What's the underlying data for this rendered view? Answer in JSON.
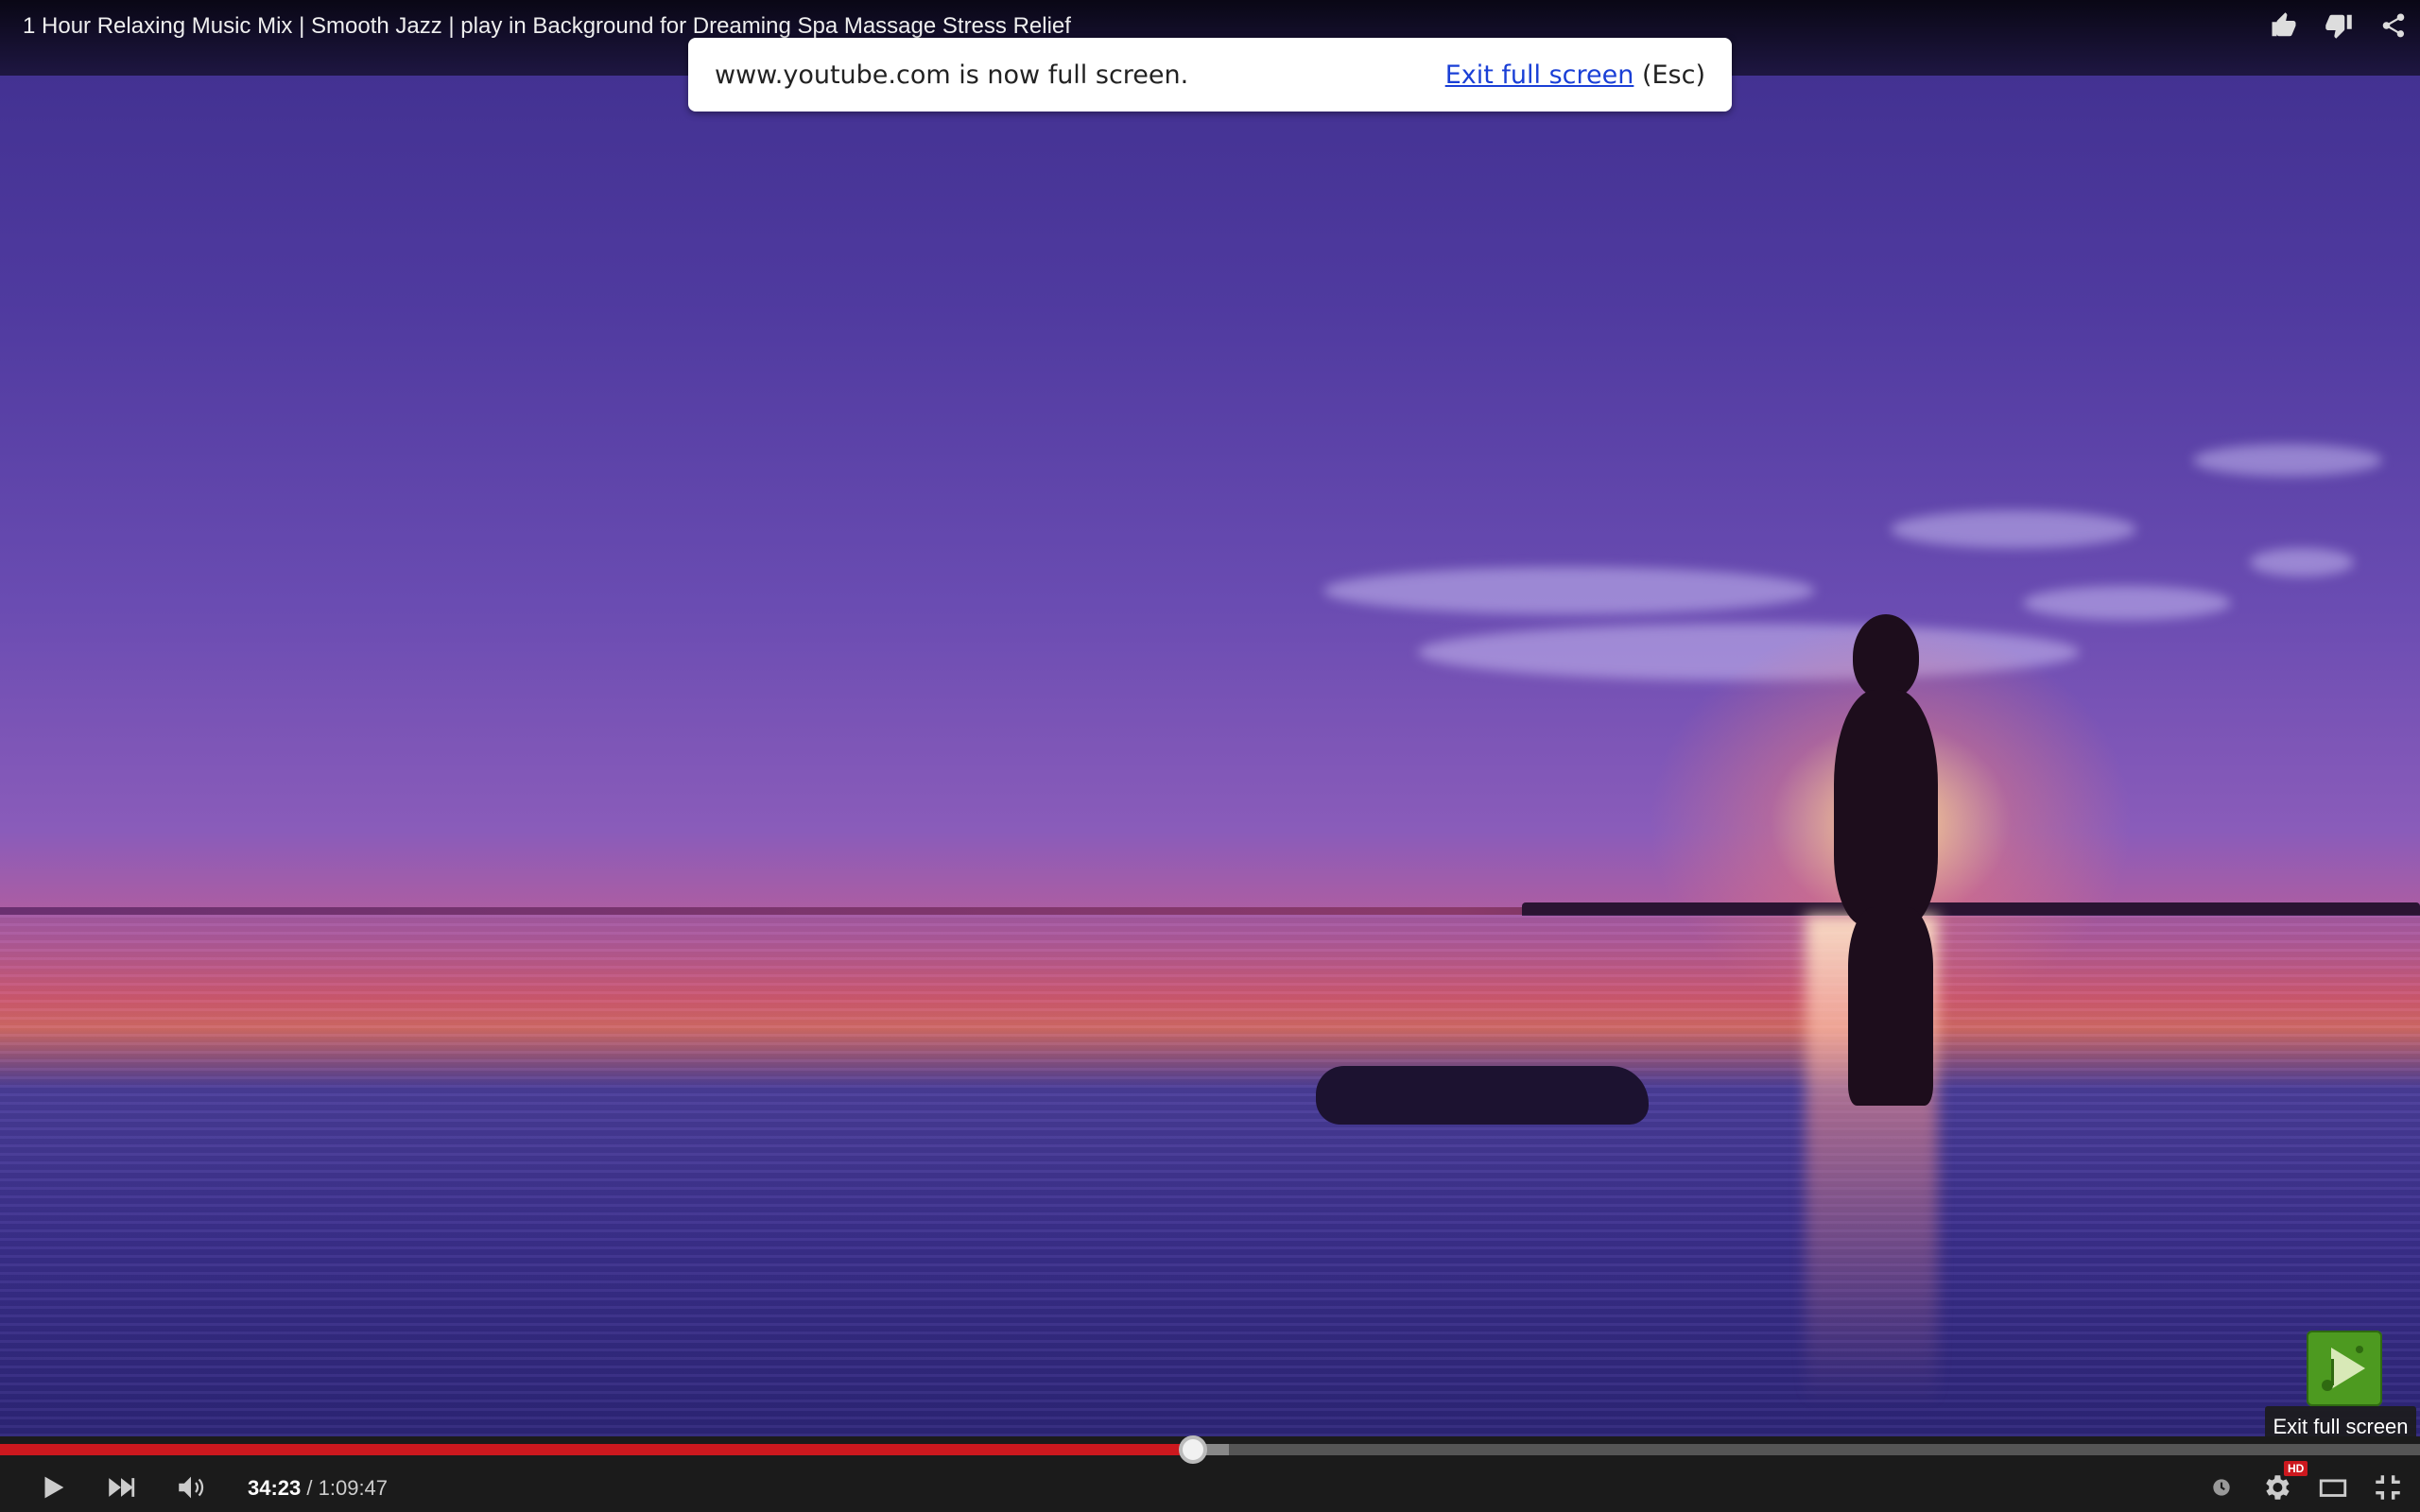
{
  "video": {
    "title": "1 Hour Relaxing Music Mix | Smooth Jazz | play in Background for Dreaming Spa Massage Stress Relief"
  },
  "top_actions": {
    "like_icon": "thumbs-up-icon",
    "dislike_icon": "thumbs-down-icon",
    "share_icon": "share-icon"
  },
  "fullscreen_notice": {
    "message": "www.youtube.com is now full screen.",
    "exit_link": "Exit full screen",
    "shortcut": "(Esc)"
  },
  "tooltip": {
    "text": "Exit full screen"
  },
  "player": {
    "current_time": "34:23",
    "separator": " / ",
    "duration": "1:09:47",
    "played_fraction": 0.4928,
    "buffered_fraction": 0.508,
    "quality_badge": "HD",
    "colors": {
      "played": "#cc181e",
      "buffered": "#888888",
      "track": "#555555"
    }
  }
}
